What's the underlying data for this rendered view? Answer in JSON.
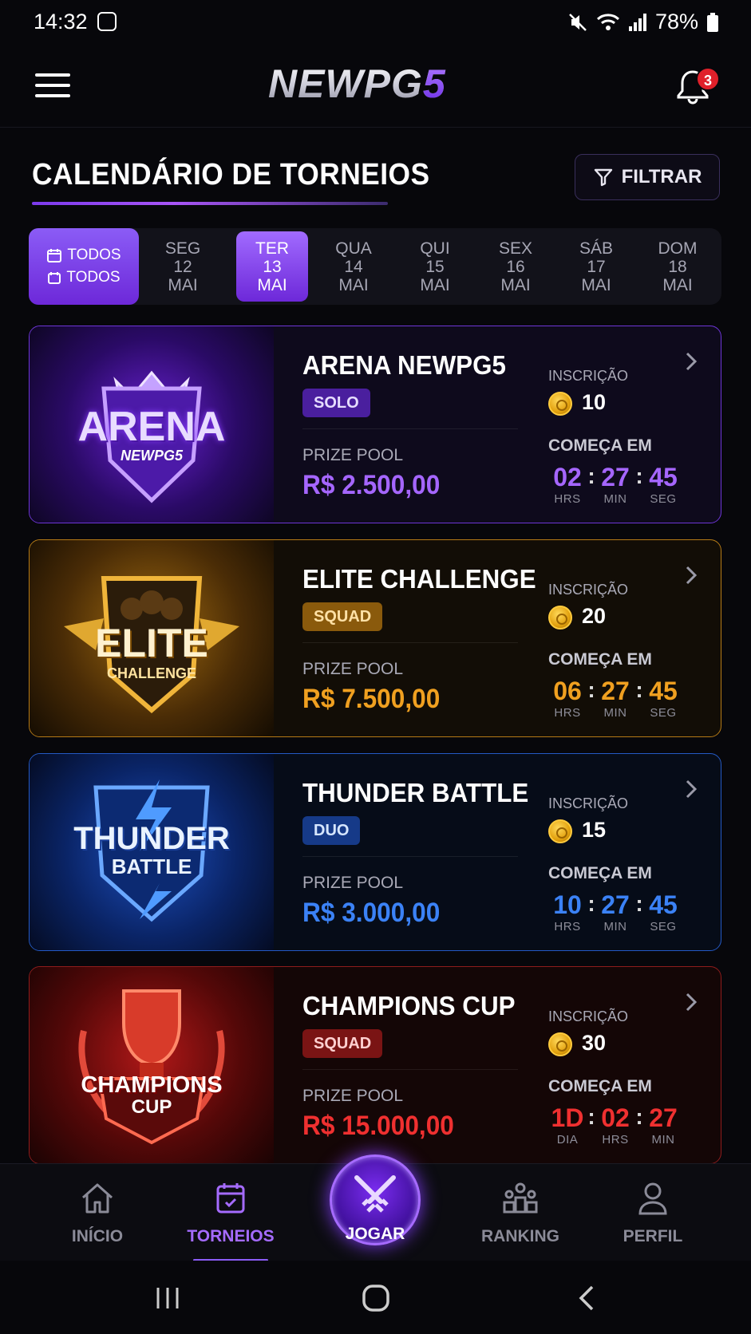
{
  "status_bar": {
    "time": "14:32",
    "battery": "78%"
  },
  "header": {
    "logo_text": "NEWPG",
    "logo_accent": "5",
    "notification_count": "3"
  },
  "page": {
    "title": "CALENDÁRIO DE TORNEIOS",
    "filter_label": "FILTRAR"
  },
  "date_tabs": {
    "all_label_1": "TODOS",
    "all_label_2": "TODOS",
    "days": [
      {
        "weekday": "SEG",
        "day": "12",
        "month": "MAI",
        "active": false
      },
      {
        "weekday": "TER",
        "day": "13",
        "month": "MAI",
        "active": true
      },
      {
        "weekday": "QUA",
        "day": "14",
        "month": "MAI",
        "active": false
      },
      {
        "weekday": "QUI",
        "day": "15",
        "month": "MAI",
        "active": false
      },
      {
        "weekday": "SEX",
        "day": "16",
        "month": "MAI",
        "active": false
      },
      {
        "weekday": "SÁB",
        "day": "17",
        "month": "MAI",
        "active": false
      },
      {
        "weekday": "DOM",
        "day": "18",
        "month": "MAI",
        "active": false
      }
    ]
  },
  "tournaments": [
    {
      "title": "ARENA NEWPG5",
      "mode": "SOLO",
      "prize_label": "PRIZE POOL",
      "prize": "R$ 2.500,00",
      "fee_label": "INSCRIÇÃO",
      "fee": "10",
      "starts_label": "COMEÇA EM",
      "timer": [
        {
          "v": "02",
          "l": "HRS"
        },
        {
          "v": "27",
          "l": "MIN"
        },
        {
          "v": "45",
          "l": "SEG"
        }
      ],
      "art_line1": "ARENA",
      "art_line2": "NEWPG5",
      "accent": "#a566ff",
      "badge_bg": "#4a1f9e",
      "border": "#6d35d6",
      "bg": "#0e0a1c"
    },
    {
      "title": "ELITE CHALLENGE",
      "mode": "SQUAD",
      "prize_label": "PRIZE POOL",
      "prize": "R$ 7.500,00",
      "fee_label": "INSCRIÇÃO",
      "fee": "20",
      "starts_label": "COMEÇA EM",
      "timer": [
        {
          "v": "06",
          "l": "HRS"
        },
        {
          "v": "27",
          "l": "MIN"
        },
        {
          "v": "45",
          "l": "SEG"
        }
      ],
      "art_line1": "ELITE",
      "art_line2": "CHALLENGE",
      "accent": "#f0a020",
      "badge_bg": "#8a5a0c",
      "border": "#b57a16",
      "bg": "#120d06"
    },
    {
      "title": "THUNDER BATTLE",
      "mode": "DUO",
      "prize_label": "PRIZE POOL",
      "prize": "R$ 3.000,00",
      "fee_label": "INSCRIÇÃO",
      "fee": "15",
      "starts_label": "COMEÇA EM",
      "timer": [
        {
          "v": "10",
          "l": "HRS"
        },
        {
          "v": "27",
          "l": "MIN"
        },
        {
          "v": "45",
          "l": "SEG"
        }
      ],
      "art_line1": "THUNDER",
      "art_line2": "BATTLE",
      "accent": "#3b82f6",
      "badge_bg": "#163a88",
      "border": "#2459c4",
      "bg": "#060c18"
    },
    {
      "title": "CHAMPIONS CUP",
      "mode": "SQUAD",
      "prize_label": "PRIZE POOL",
      "prize": "R$ 15.000,00",
      "fee_label": "INSCRIÇÃO",
      "fee": "30",
      "starts_label": "COMEÇA EM",
      "timer": [
        {
          "v": "1D",
          "l": "DIA"
        },
        {
          "v": "02",
          "l": "HRS"
        },
        {
          "v": "27",
          "l": "MIN"
        }
      ],
      "art_line1": "CHAMPIONS",
      "art_line2": "CUP",
      "accent": "#ef3030",
      "badge_bg": "#7a1414",
      "border": "#8e1c1c",
      "bg": "#140606"
    }
  ],
  "bottom_nav": {
    "items": [
      {
        "label": "INÍCIO",
        "icon": "home-icon"
      },
      {
        "label": "TORNEIOS",
        "icon": "calendar-icon"
      },
      {
        "label": "RANKING",
        "icon": "ranking-icon"
      },
      {
        "label": "PERFIL",
        "icon": "profile-icon"
      }
    ],
    "play_label": "JOGAR"
  }
}
